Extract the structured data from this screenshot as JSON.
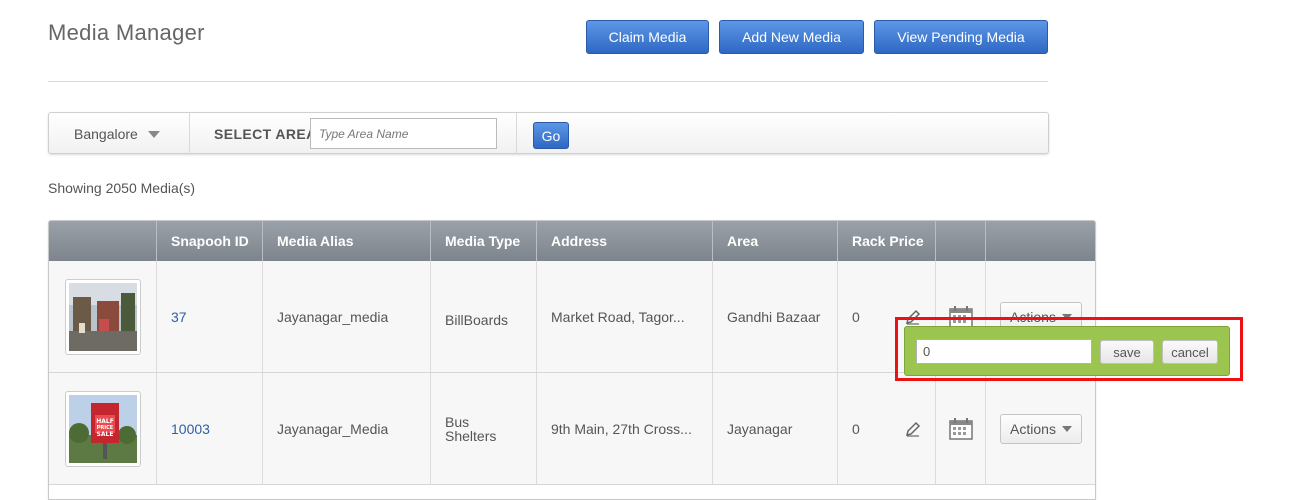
{
  "header": {
    "title": "Media Manager",
    "buttons": {
      "claim": "Claim Media",
      "add": "Add New Media",
      "pending": "View Pending Media"
    }
  },
  "filter": {
    "city": "Bangalore",
    "select_area_label": "SELECT AREA",
    "area_placeholder": "Type Area Name",
    "go_label": "Go"
  },
  "summary": {
    "showing": "Showing 2050 Media(s)"
  },
  "table": {
    "columns": [
      "",
      "Snapooh ID",
      "Media Alias",
      "Media Type",
      "Address",
      "Area",
      "Rack Price",
      "",
      ""
    ],
    "rows": [
      {
        "id": "37",
        "alias": "Jayanagar_media",
        "type": "BillBoards",
        "address": "Market Road, Tagor...",
        "area": "Gandhi Bazaar",
        "price": "0",
        "actions": "Actions"
      },
      {
        "id": "10003",
        "alias": "Jayanagar_Media",
        "type": "Bus Shelters",
        "address": "9th Main, 27th Cross...",
        "area": "Jayanagar",
        "price": "0",
        "actions": "Actions"
      }
    ]
  },
  "price_popup": {
    "value": "0",
    "save": "save",
    "cancel": "cancel"
  }
}
